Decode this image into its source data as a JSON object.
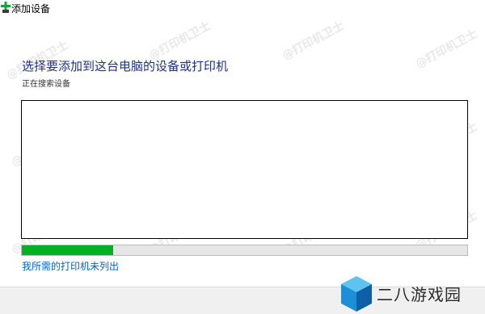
{
  "window": {
    "title": "添加设备",
    "icon": "add-device-plus-icon"
  },
  "main": {
    "heading": "选择要添加到这台电脑的设备或打印机",
    "status": "正在搜索设备",
    "progress_fraction": 0.205,
    "progress_color": "#06b025",
    "link_text": "我所需的打印机未列出"
  },
  "watermark": {
    "text": "@打印机卫士"
  },
  "brand": {
    "text": "二八游戏园",
    "logo": "cube-logo"
  }
}
